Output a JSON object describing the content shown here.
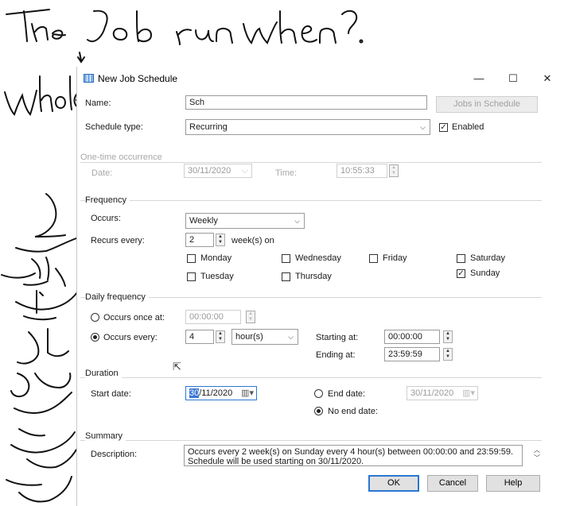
{
  "annotations": {
    "top_line": "The Job run when?",
    "left_word": "whole",
    "side_notes": "Handwritten Arabic notes"
  },
  "window": {
    "title": "New Job Schedule",
    "minimize": "—",
    "maximize": "☐",
    "close": "✕"
  },
  "form": {
    "name_label": "Name:",
    "name_value": "Sch",
    "jobs_button": "Jobs in Schedule",
    "schedule_type_label": "Schedule type:",
    "schedule_type_value": "Recurring",
    "enabled_label": "Enabled",
    "enabled_checked": true
  },
  "one_time": {
    "group_label": "One-time occurrence",
    "date_label": "Date:",
    "date_value": "30/11/2020",
    "time_label": "Time:",
    "time_value": "10:55:33"
  },
  "frequency": {
    "group_label": "Frequency",
    "occurs_label": "Occurs:",
    "occurs_value": "Weekly",
    "recurs_label": "Recurs every:",
    "recurs_value": "2",
    "recurs_unit": "week(s) on",
    "days": {
      "monday": "Monday",
      "tuesday": "Tuesday",
      "wednesday": "Wednesday",
      "thursday": "Thursday",
      "friday": "Friday",
      "saturday": "Saturday",
      "sunday": "Sunday"
    }
  },
  "daily": {
    "group_label": "Daily frequency",
    "once_label": "Occurs once at:",
    "once_value": "00:00:00",
    "every_label": "Occurs every:",
    "every_value": "4",
    "every_unit": "hour(s)",
    "starting_label": "Starting at:",
    "starting_value": "00:00:00",
    "ending_label": "Ending at:",
    "ending_value": "23:59:59"
  },
  "duration": {
    "group_label": "Duration",
    "start_label": "Start date:",
    "start_day": "30",
    "start_rest": "/11/2020",
    "end_label": "End date:",
    "end_value": "30/11/2020",
    "no_end_label": "No end date:"
  },
  "summary": {
    "group_label": "Summary",
    "description_label": "Description:",
    "description_text": "Occurs every 2 week(s) on Sunday every 4 hour(s) between 00:00:00 and 23:59:59. Schedule will be used starting on 30/11/2020."
  },
  "buttons": {
    "ok": "OK",
    "cancel": "Cancel",
    "help": "Help"
  },
  "colors": {
    "accent": "#2a77d2",
    "ink": "#111111"
  }
}
